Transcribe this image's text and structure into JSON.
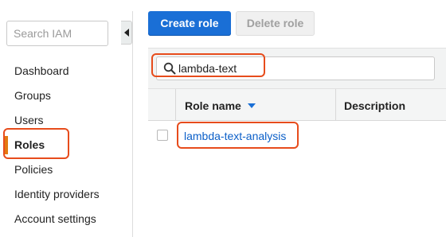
{
  "sidebar": {
    "search_placeholder": "Search IAM",
    "items": [
      {
        "label": "Dashboard"
      },
      {
        "label": "Groups"
      },
      {
        "label": "Users"
      },
      {
        "label": "Roles",
        "active": true
      },
      {
        "label": "Policies"
      },
      {
        "label": "Identity providers"
      },
      {
        "label": "Account settings"
      }
    ],
    "collapse_icon": "caret-left-icon"
  },
  "toolbar": {
    "create_label": "Create role",
    "delete_label": "Delete role"
  },
  "filter": {
    "value": "lambda-text",
    "icon": "search-icon"
  },
  "table": {
    "columns": [
      "Role name",
      "Description"
    ],
    "sort_icon": "sort-desc-icon",
    "rows": [
      {
        "role_name": "lambda-text-analysis",
        "description": ""
      }
    ]
  },
  "colors": {
    "accent_blue": "#1a6fd6",
    "link": "#0b5fc8",
    "active_nav_bar": "#e47911",
    "highlight": "#e74c1c"
  }
}
